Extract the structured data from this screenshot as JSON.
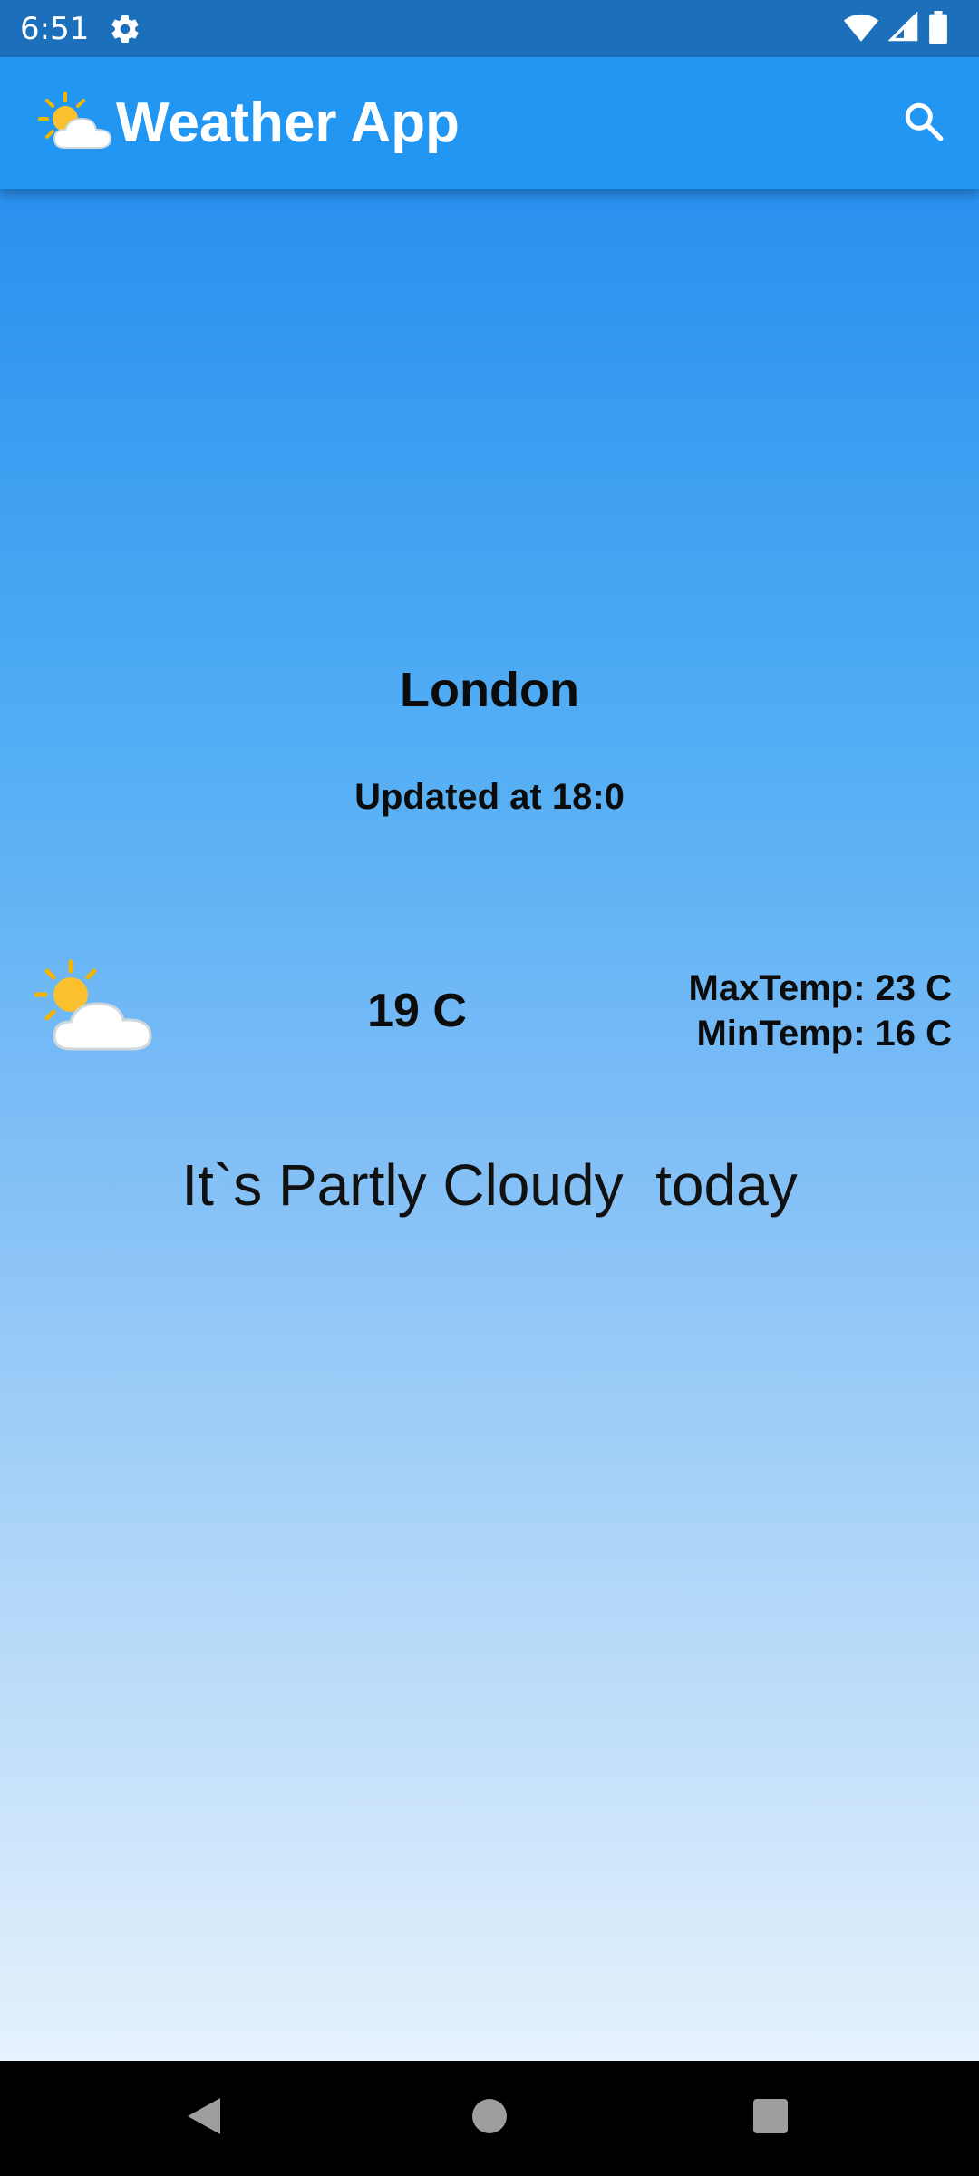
{
  "status_bar": {
    "time": "6:51",
    "icons": [
      "gear-icon",
      "wifi-icon",
      "cellular-signal-icon",
      "battery-icon"
    ]
  },
  "app_bar": {
    "title": "Weather App",
    "logo_icon": "partly-cloudy-icon",
    "search_icon": "search-icon",
    "background_color": "#2196f3"
  },
  "weather": {
    "city": "London",
    "updated": "Updated at 18:0",
    "current_temp": "19 C",
    "max_temp": "MaxTemp: 23 C",
    "min_temp": "MinTemp: 16 C",
    "condition_text": "It`s Partly Cloudy  today",
    "condition_icon": "partly-cloudy-icon"
  },
  "nav_bar": {
    "buttons": [
      "back-icon",
      "home-icon",
      "recents-icon"
    ]
  },
  "colors": {
    "status_bar": "#1c6fba",
    "gradient_top": "#2890ee",
    "gradient_bottom": "#e6f2fd",
    "text": "#0c0c0c"
  }
}
